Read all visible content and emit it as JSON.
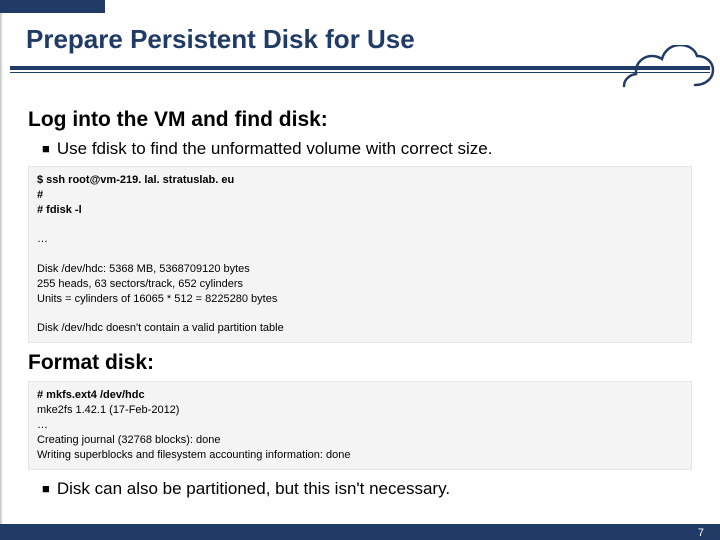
{
  "slide": {
    "title": "Prepare Persistent Disk for Use",
    "section1": {
      "heading": "Log into the VM and find disk:",
      "bullet": "Use fdisk to find the unformatted volume with correct size.",
      "code_bold": "$ ssh root@vm-219. lal. stratuslab. eu\n#\n# fdisk -l",
      "code_rest": "\n\n…\n\nDisk /dev/hdc: 5368 MB, 5368709120 bytes\n255 heads, 63 sectors/track, 652 cylinders\nUnits = cylinders of 16065 * 512 = 8225280 bytes\n\nDisk /dev/hdc doesn't contain a valid partition table"
    },
    "section2": {
      "heading": "Format disk:",
      "code_bold": "# mkfs.ext4 /dev/hdc",
      "code_rest": "\nmke2fs 1.42.1 (17-Feb-2012)\n…\nCreating journal (32768 blocks): done\nWriting superblocks and filesystem accounting information: done",
      "bullet": "Disk can also be partitioned, but this isn't necessary."
    },
    "page_number": "7"
  }
}
